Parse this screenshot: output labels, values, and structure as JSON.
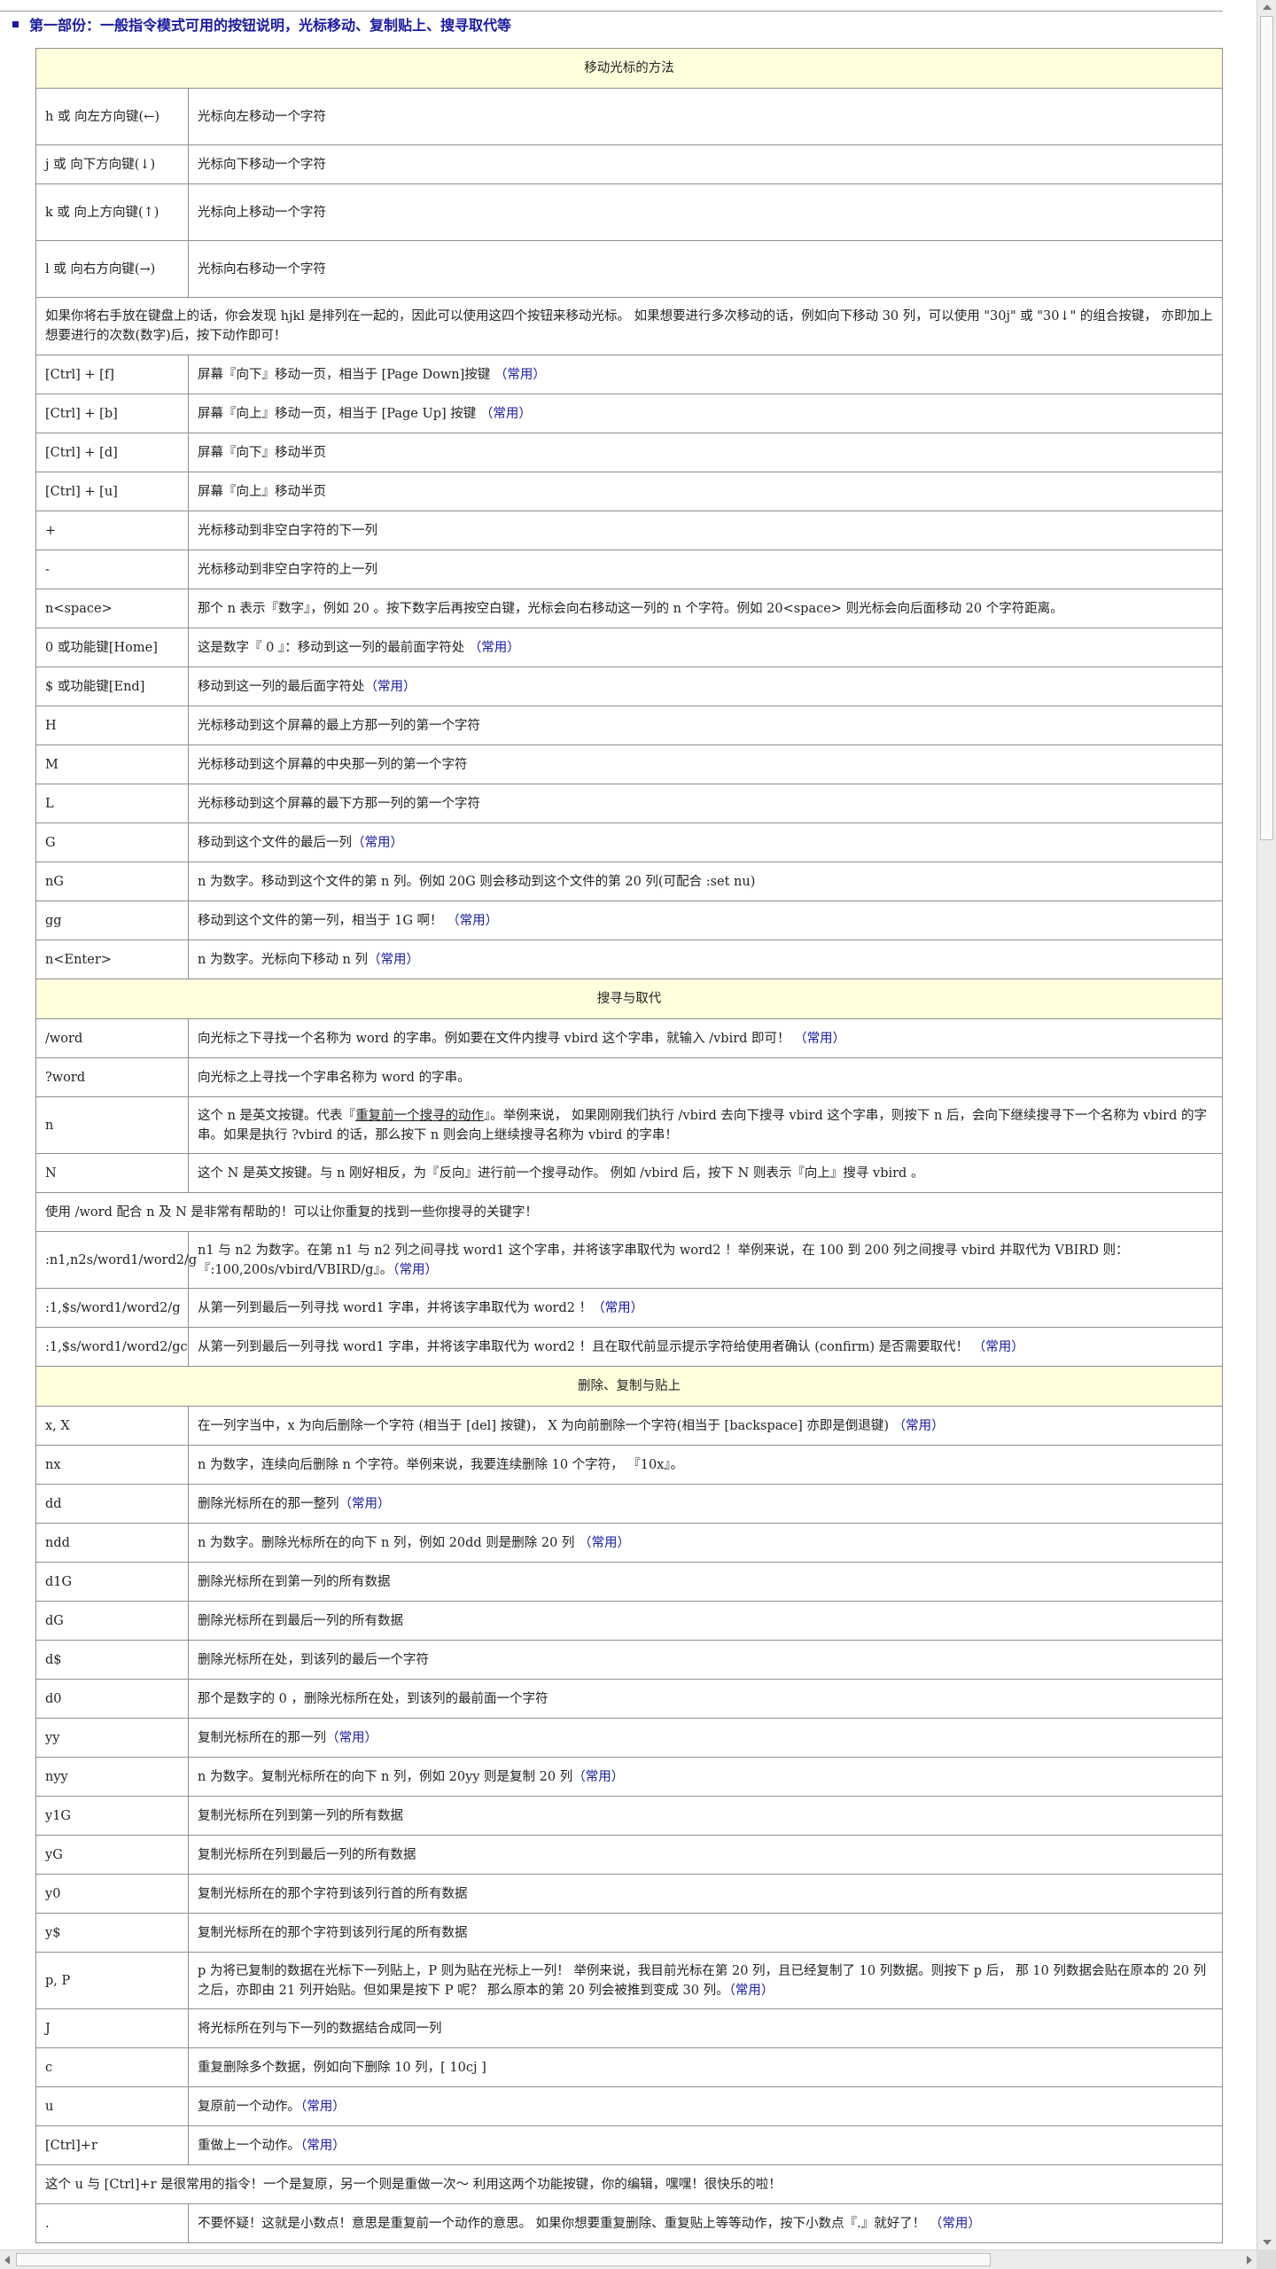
{
  "heading": "第一部份：一般指令模式可用的按钮说明，光标移动、复制贴上、搜寻取代等",
  "common_label": "（常用）",
  "sections": {
    "move_header": "移动光标的方法",
    "search_header": "搜寻与取代",
    "delete_header": "删除、复制与贴上"
  },
  "rows": {
    "r01": {
      "key": "h 或 向左方向键(←)",
      "desc": "光标向左移动一个字符"
    },
    "r02": {
      "key": "j 或 向下方向键(↓)",
      "desc": "光标向下移动一个字符"
    },
    "r03": {
      "key": "k 或 向上方向键(↑)",
      "desc": "光标向上移动一个字符"
    },
    "r04": {
      "key": "l 或 向右方向键(→)",
      "desc": "光标向右移动一个字符"
    },
    "n01": "如果你将右手放在键盘上的话，你会发现 hjkl 是排列在一起的，因此可以使用这四个按钮来移动光标。 如果想要进行多次移动的话，例如向下移动 30 列，可以使用 \"30j\" 或 \"30↓\" 的组合按键， 亦即加上想要进行的次数(数字)后，按下动作即可！",
    "r05": {
      "key": "[Ctrl] + [f]",
      "desc": "屏幕『向下』移动一页，相当于 [Page Down]按键"
    },
    "r06": {
      "key": "[Ctrl] + [b]",
      "desc": "屏幕『向上』移动一页，相当于 [Page Up] 按键"
    },
    "r07": {
      "key": "[Ctrl] + [d]",
      "desc": "屏幕『向下』移动半页"
    },
    "r08": {
      "key": "[Ctrl] + [u]",
      "desc": "屏幕『向上』移动半页"
    },
    "r09": {
      "key": "+",
      "desc": "光标移动到非空白字符的下一列"
    },
    "r10": {
      "key": "-",
      "desc": "光标移动到非空白字符的上一列"
    },
    "r11": {
      "key": "n<space>",
      "desc": "那个 n 表示『数字』，例如 20 。按下数字后再按空白键，光标会向右移动这一列的 n 个字符。例如 20<space> 则光标会向后面移动 20 个字符距离。"
    },
    "r12": {
      "key": "0 或功能键[Home]",
      "desc": "这是数字『 0 』：移动到这一列的最前面字符处"
    },
    "r13": {
      "key": "$ 或功能键[End]",
      "desc": "移动到这一列的最后面字符处"
    },
    "r14": {
      "key": "H",
      "desc": "光标移动到这个屏幕的最上方那一列的第一个字符"
    },
    "r15": {
      "key": "M",
      "desc": "光标移动到这个屏幕的中央那一列的第一个字符"
    },
    "r16": {
      "key": "L",
      "desc": "光标移动到这个屏幕的最下方那一列的第一个字符"
    },
    "r17": {
      "key": "G",
      "desc": "移动到这个文件的最后一列"
    },
    "r18": {
      "key": "nG",
      "desc": "n 为数字。移动到这个文件的第 n 列。例如 20G 则会移动到这个文件的第 20 列(可配合 :set nu)"
    },
    "r19": {
      "key": "gg",
      "desc": "移动到这个文件的第一列，相当于 1G 啊！"
    },
    "r20": {
      "key": "n<Enter>",
      "desc": "n 为数字。光标向下移动 n 列"
    },
    "r21": {
      "key": "/word",
      "desc": "向光标之下寻找一个名称为 word 的字串。例如要在文件内搜寻 vbird 这个字串，就输入 /vbird 即可！"
    },
    "r22": {
      "key": "?word",
      "desc": "向光标之上寻找一个字串名称为 word 的字串。"
    },
    "r23": {
      "key": "n",
      "desc_a": "这个 n 是英文按键。代表『",
      "desc_u": "重复前一个搜寻的动作",
      "desc_b": "』。举例来说， 如果刚刚我们执行 /vbird 去向下搜寻 vbird 这个字串，则按下 n 后，会向下继续搜寻下一个名称为 vbird 的字串。如果是执行 ?vbird 的话，那么按下 n 则会向上继续搜寻名称为 vbird 的字串！"
    },
    "r24": {
      "key": "N",
      "desc": "这个 N 是英文按键。与 n 刚好相反，为『反向』进行前一个搜寻动作。 例如 /vbird 后，按下 N 则表示『向上』搜寻 vbird 。"
    },
    "n02": "使用 /word 配合 n 及 N 是非常有帮助的！可以让你重复的找到一些你搜寻的关键字！",
    "r25": {
      "key": ":n1,n2s/word1/word2/g",
      "desc": "n1 与 n2 为数字。在第 n1 与 n2 列之间寻找 word1 这个字串，并将该字串取代为 word2 ！举例来说，在 100 到 200 列之间搜寻 vbird 并取代为 VBIRD 则：『:100,200s/vbird/VBIRD/g』。"
    },
    "r26": {
      "key": ":1,$s/word1/word2/g",
      "desc": "从第一列到最后一列寻找 word1 字串，并将该字串取代为 word2 ！"
    },
    "r27": {
      "key": ":1,$s/word1/word2/gc",
      "desc": "从第一列到最后一列寻找 word1 字串，并将该字串取代为 word2 ！且在取代前显示提示字符给使用者确认 (confirm) 是否需要取代！"
    },
    "r28": {
      "key": "x, X",
      "desc": "在一列字当中，x 为向后删除一个字符 (相当于 [del] 按键)， X 为向前删除一个字符(相当于 [backspace] 亦即是倒退键)"
    },
    "r29": {
      "key": "nx",
      "desc": "n 为数字，连续向后删除 n 个字符。举例来说，我要连续删除 10 个字符， 『10x』。"
    },
    "r30": {
      "key": "dd",
      "desc": "删除光标所在的那一整列"
    },
    "r31": {
      "key": "ndd",
      "desc": "n 为数字。删除光标所在的向下 n 列，例如 20dd 则是删除 20 列"
    },
    "r32": {
      "key": "d1G",
      "desc": "删除光标所在到第一列的所有数据"
    },
    "r33": {
      "key": "dG",
      "desc": "删除光标所在到最后一列的所有数据"
    },
    "r34": {
      "key": "d$",
      "desc": "删除光标所在处，到该列的最后一个字符"
    },
    "r35": {
      "key": "d0",
      "desc": "那个是数字的 0 ，删除光标所在处，到该列的最前面一个字符"
    },
    "r36": {
      "key": "yy",
      "desc": "复制光标所在的那一列"
    },
    "r37": {
      "key": "nyy",
      "desc": "n 为数字。复制光标所在的向下 n 列，例如 20yy 则是复制 20 列"
    },
    "r38": {
      "key": "y1G",
      "desc": "复制光标所在列到第一列的所有数据"
    },
    "r39": {
      "key": "yG",
      "desc": "复制光标所在列到最后一列的所有数据"
    },
    "r40": {
      "key": "y0",
      "desc": "复制光标所在的那个字符到该列行首的所有数据"
    },
    "r41": {
      "key": "y$",
      "desc": "复制光标所在的那个字符到该列行尾的所有数据"
    },
    "r42": {
      "key": "p, P",
      "desc": "p 为将已复制的数据在光标下一列贴上，P 则为贴在光标上一列！ 举例来说，我目前光标在第 20 列，且已经复制了 10 列数据。则按下 p 后， 那 10 列数据会贴在原本的 20 列之后，亦即由 21 列开始贴。但如果是按下 P 呢？ 那么原本的第 20 列会被推到变成 30 列。"
    },
    "r43": {
      "key": "J",
      "desc": "将光标所在列与下一列的数据结合成同一列"
    },
    "r44": {
      "key": "c",
      "desc": "重复删除多个数据，例如向下删除 10 列，[ 10cj ]"
    },
    "r45": {
      "key": "u",
      "desc": "复原前一个动作。"
    },
    "r46": {
      "key": "[Ctrl]+r",
      "desc": "重做上一个动作。"
    },
    "n03": "这个 u 与 [Ctrl]+r 是很常用的指令！一个是复原，另一个则是重做一次～ 利用这两个功能按键，你的编辑，嘿嘿！很快乐的啦！",
    "r47": {
      "key": ".",
      "desc": "不要怀疑！这就是小数点！意思是重复前一个动作的意思。 如果你想要重复删除、重复贴上等等动作，按下小数点『.』就好了！"
    }
  }
}
